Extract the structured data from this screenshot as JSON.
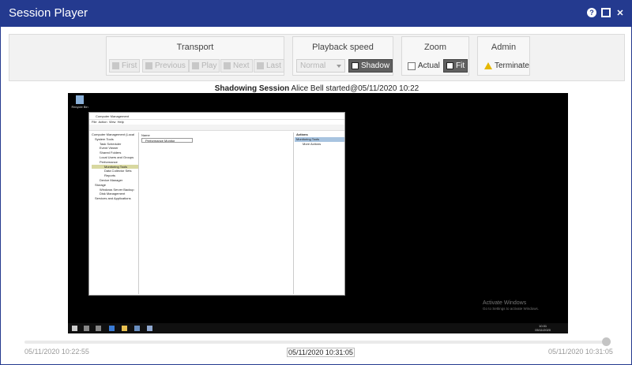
{
  "window": {
    "title": "Session Player"
  },
  "toolbar": {
    "transport": {
      "title": "Transport",
      "buttons": [
        {
          "label": "First",
          "icon": "skip-first-icon"
        },
        {
          "label": "Previous",
          "icon": "previous-icon"
        },
        {
          "label": "Play",
          "icon": "play-icon"
        },
        {
          "label": "Next",
          "icon": "next-icon"
        },
        {
          "label": "Last",
          "icon": "skip-last-icon"
        }
      ]
    },
    "playback_speed": {
      "title": "Playback speed",
      "selected": "Normal",
      "shadow_label": "Shadow"
    },
    "zoom": {
      "title": "Zoom",
      "actual_label": "Actual",
      "fit_label": "Fit"
    },
    "admin": {
      "title": "Admin",
      "terminate_label": "Terminate"
    }
  },
  "session": {
    "heading": "Shadowing Session",
    "description": "Alice Bell started@05/11/2020 10:22"
  },
  "remote_desktop": {
    "recycle_bin": "Recycle Bin",
    "mmc": {
      "title": "Computer Management",
      "menu": [
        "File",
        "Action",
        "View",
        "Help"
      ],
      "tree": [
        "Computer Management (Local",
        "System Tools",
        "Task Scheduler",
        "Event Viewer",
        "Shared Folders",
        "Local Users and Groups",
        "Performance",
        "Monitoring Tools",
        "Data Collector Sets",
        "Reports",
        "Device Manager",
        "Storage",
        "Windows Server Backup",
        "Disk Management",
        "Services and Applications"
      ],
      "mid_header": "Name",
      "mid_item": "Performance Monitor",
      "actions_header": "Actions",
      "actions_selected": "Monitoring Tools",
      "actions_more": "More Actions"
    },
    "activate_title": "Activate Windows",
    "activate_sub": "Go to Settings to activate Windows.",
    "clock_time": "10:31",
    "clock_date": "05/11/2020"
  },
  "timeline": {
    "start": "05/11/2020 10:22:55",
    "current": "05/11/2020 10:31:05",
    "end": "05/11/2020 10:31:05",
    "progress": 1.0
  },
  "colors": {
    "titlebar": "#243a8f",
    "shadow_active": "#606060"
  }
}
